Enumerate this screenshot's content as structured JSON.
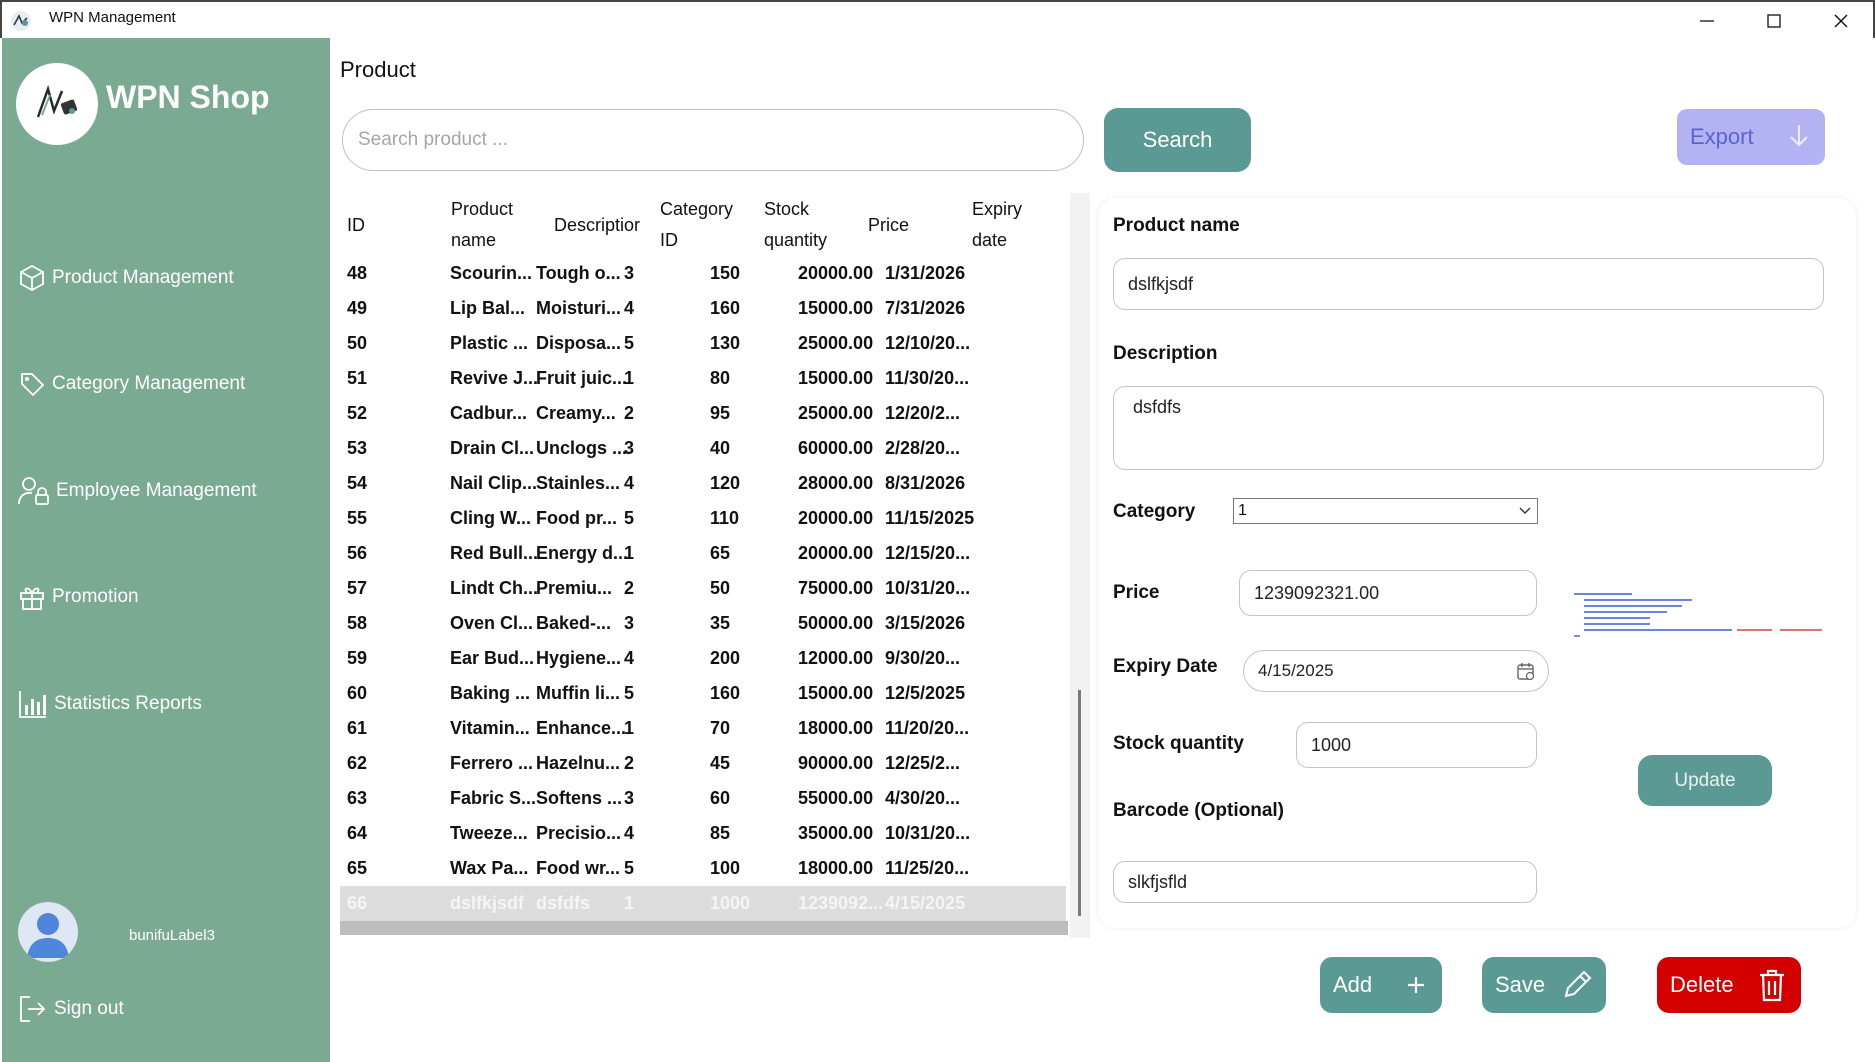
{
  "window": {
    "title": "WPN Management"
  },
  "sidebar": {
    "brand": "WPN Shop",
    "items": [
      {
        "label": "Product Management",
        "icon": "box-icon"
      },
      {
        "label": "Category Management",
        "icon": "tag-icon"
      },
      {
        "label": "Employee Management",
        "icon": "user-lock-icon"
      },
      {
        "label": "Promotion",
        "icon": "gift-icon"
      },
      {
        "label": "Statistics Reports",
        "icon": "bar-chart-icon"
      }
    ],
    "user": "bunifuLabel3",
    "signout": "Sign out"
  },
  "main": {
    "title": "Product",
    "search": {
      "placeholder": "Search product ...",
      "button": "Search"
    },
    "export": "Export"
  },
  "table": {
    "headers": {
      "id": "ID",
      "name_1": "Product",
      "name_2": "name",
      "desc": "Descriptior",
      "cat_1": "Category",
      "cat_2": "ID",
      "stock_1": "Stock",
      "stock_2": "quantity",
      "price": "Price",
      "exp_1": "Expiry",
      "exp_2": "date"
    },
    "rows": [
      {
        "id": "48",
        "name": "Scourin...",
        "desc": "Tough o...",
        "cat": "3",
        "stock": "150",
        "price": "20000.00",
        "exp": "1/31/2026"
      },
      {
        "id": "49",
        "name": "Lip Bal...",
        "desc": "Moisturi...",
        "cat": "4",
        "stock": "160",
        "price": "15000.00",
        "exp": "7/31/2026"
      },
      {
        "id": "50",
        "name": "Plastic ...",
        "desc": "Disposa...",
        "cat": "5",
        "stock": "130",
        "price": "25000.00",
        "exp": "12/10/20..."
      },
      {
        "id": "51",
        "name": "Revive J...",
        "desc": "Fruit juic...",
        "cat": "1",
        "stock": "80",
        "price": "15000.00",
        "exp": "11/30/20..."
      },
      {
        "id": "52",
        "name": "Cadbur...",
        "desc": "Creamy...",
        "cat": "2",
        "stock": "95",
        "price": "25000.00",
        "exp": "12/20/2..."
      },
      {
        "id": "53",
        "name": "Drain Cl...",
        "desc": "Unclogs ...",
        "cat": "3",
        "stock": "40",
        "price": "60000.00",
        "exp": "2/28/20..."
      },
      {
        "id": "54",
        "name": "Nail Clip...",
        "desc": "Stainles...",
        "cat": "4",
        "stock": "120",
        "price": "28000.00",
        "exp": "8/31/2026"
      },
      {
        "id": "55",
        "name": "Cling W...",
        "desc": "Food pr...",
        "cat": "5",
        "stock": "110",
        "price": "20000.00",
        "exp": "11/15/2025"
      },
      {
        "id": "56",
        "name": "Red Bull...",
        "desc": "Energy d...",
        "cat": "1",
        "stock": "65",
        "price": "20000.00",
        "exp": "12/15/20..."
      },
      {
        "id": "57",
        "name": "Lindt Ch...",
        "desc": "Premiu...",
        "cat": "2",
        "stock": "50",
        "price": "75000.00",
        "exp": "10/31/20..."
      },
      {
        "id": "58",
        "name": "Oven Cl...",
        "desc": "Baked-...",
        "cat": "3",
        "stock": "35",
        "price": "50000.00",
        "exp": "3/15/2026"
      },
      {
        "id": "59",
        "name": "Ear Bud...",
        "desc": "Hygiene...",
        "cat": "4",
        "stock": "200",
        "price": "12000.00",
        "exp": "9/30/20..."
      },
      {
        "id": "60",
        "name": "Baking ...",
        "desc": "Muffin li...",
        "cat": "5",
        "stock": "160",
        "price": "15000.00",
        "exp": "12/5/2025"
      },
      {
        "id": "61",
        "name": "Vitamin...",
        "desc": "Enhance...",
        "cat": "1",
        "stock": "70",
        "price": "18000.00",
        "exp": "11/20/20..."
      },
      {
        "id": "62",
        "name": "Ferrero ...",
        "desc": "Hazelnu...",
        "cat": "2",
        "stock": "45",
        "price": "90000.00",
        "exp": "12/25/2..."
      },
      {
        "id": "63",
        "name": "Fabric S...",
        "desc": "Softens ...",
        "cat": "3",
        "stock": "60",
        "price": "55000.00",
        "exp": "4/30/20..."
      },
      {
        "id": "64",
        "name": "Tweeze...",
        "desc": "Precisio...",
        "cat": "4",
        "stock": "85",
        "price": "35000.00",
        "exp": "10/31/20..."
      },
      {
        "id": "65",
        "name": "Wax Pa...",
        "desc": "Food wr...",
        "cat": "5",
        "stock": "100",
        "price": "18000.00",
        "exp": "11/25/20..."
      },
      {
        "id": "66",
        "name": "dslfkjsdf",
        "desc": "dsfdfs",
        "cat": "1",
        "stock": "1000",
        "price": "1239092...",
        "exp": "4/15/2025",
        "selected": true
      }
    ]
  },
  "form": {
    "product_name_label": "Product name",
    "product_name": "dslfkjsdf",
    "description_label": "Description",
    "description": "dsfdfs",
    "category_label": "Category",
    "category": "1",
    "price_label": "Price",
    "price": "1239092321.00",
    "expiry_label": "Expiry Date",
    "expiry": "4/15/2025",
    "stock_label": "Stock quantity",
    "stock": "1000",
    "barcode_label": "Barcode (Optional)",
    "barcode": "slkfjsfld",
    "update": "Update"
  },
  "actions": {
    "add": "Add",
    "save": "Save",
    "delete": "Delete"
  },
  "colors": {
    "sidebar": "#7aaa92",
    "primary": "#5b9a94",
    "export_bg": "#b3b3f4",
    "export_text": "#5a63d6",
    "danger": "#d40000"
  }
}
